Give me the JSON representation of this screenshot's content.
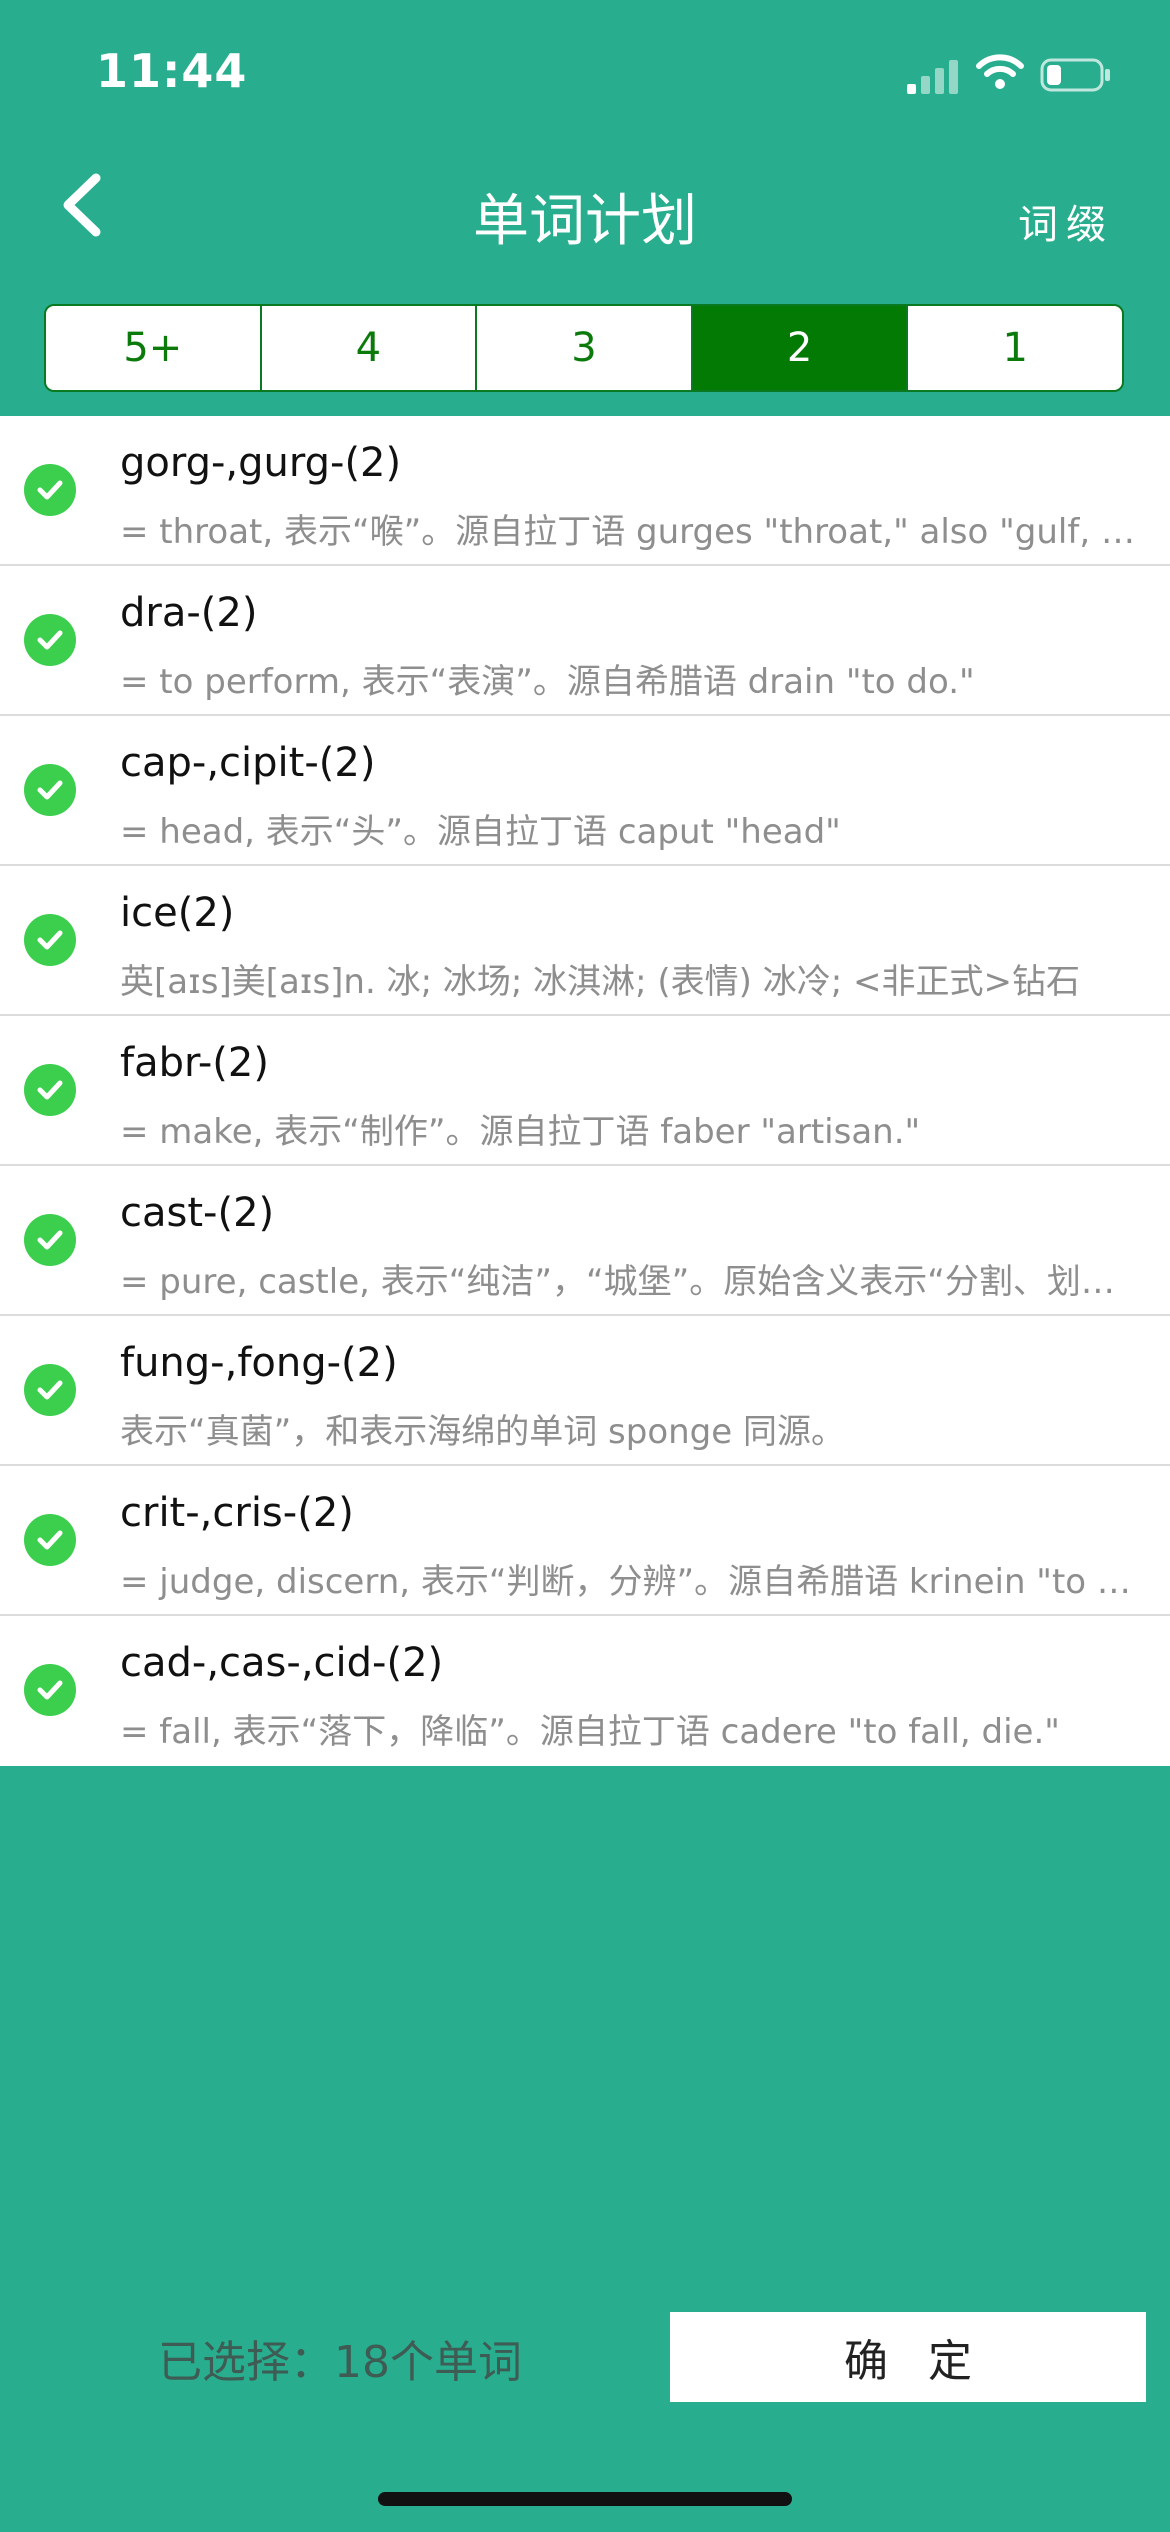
{
  "status_bar": {
    "time": "11:44"
  },
  "nav": {
    "title": "单词计划",
    "right_label": "词缀"
  },
  "segments": [
    {
      "label": "5+",
      "active": false
    },
    {
      "label": "4",
      "active": false
    },
    {
      "label": "3",
      "active": false
    },
    {
      "label": "2",
      "active": true
    },
    {
      "label": "1",
      "active": false
    }
  ],
  "items": [
    {
      "word": "gorg-,gurg-(2)",
      "desc": "= throat, 表示“喉”。源自拉丁语 gurges \"throat,\" also \"gulf, whirlpool.\""
    },
    {
      "word": "dra-(2)",
      "desc": "= to perform, 表示“表演”。源自希腊语 drain \"to do.\""
    },
    {
      "word": "cap-,cipit-(2)",
      "desc": "= head, 表示“头”。源自拉丁语 caput \"head\""
    },
    {
      "word": "ice(2)",
      "desc": "英[aɪs]美[aɪs]n. 冰; 冰场; 冰淇淋; (表情) 冰冷; <非正式>钻石"
    },
    {
      "word": "fabr-(2)",
      "desc": "= make, 表示“制作”。源自拉丁语 faber \"artisan.\""
    },
    {
      "word": "cast-(2)",
      "desc": "= pure, castle, 表示“纯洁”，“城堡”。原始含义表示“分割、划分”。"
    },
    {
      "word": "fung-,fong-(2)",
      "desc": "表示“真菌”，和表示海绵的单词 sponge 同源。"
    },
    {
      "word": "crit-,cris-(2)",
      "desc": "= judge, discern, 表示“判断，分辨”。源自希腊语 krinein \"to separate.\""
    },
    {
      "word": "cad-,cas-,cid-(2)",
      "desc": "= fall, 表示“落下，降临”。源自拉丁语 cadere \"to fall, die.\""
    }
  ],
  "footer": {
    "selected_text": "已选择：18个单词",
    "confirm_label": "确定"
  },
  "colors": {
    "background": "#28ae8e",
    "segment_active": "#037a03",
    "check": "#3ccf4e"
  }
}
